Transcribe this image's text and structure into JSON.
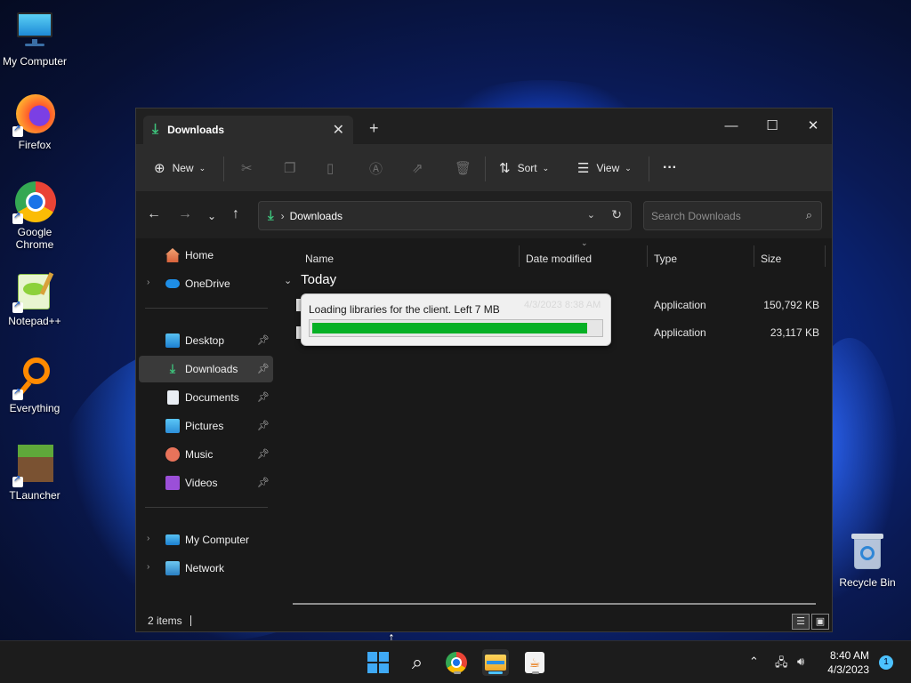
{
  "desktop": {
    "icons": [
      {
        "label": "My Computer",
        "icon": "monitor-icon"
      },
      {
        "label": "Firefox",
        "icon": "firefox-icon"
      },
      {
        "label": "Google Chrome",
        "icon": "chrome-icon"
      },
      {
        "label": "Notepad++",
        "icon": "notepadpp-icon"
      },
      {
        "label": "Everything",
        "icon": "everything-search-icon"
      },
      {
        "label": "TLauncher",
        "icon": "tlauncher-icon"
      },
      {
        "label": "Recycle Bin",
        "icon": "recycle-bin-icon"
      }
    ]
  },
  "window": {
    "tab_title": "Downloads",
    "new_tab": "+",
    "controls": {
      "minimize": "—",
      "maximize": "☐",
      "close": "✕"
    },
    "toolbar": {
      "new_label": "New",
      "sort_label": "Sort",
      "view_label": "View",
      "more_label": "···"
    },
    "address": {
      "crumb": "Downloads"
    },
    "search": {
      "placeholder": "Search Downloads"
    },
    "sidebar": {
      "items": [
        {
          "label": "Home"
        },
        {
          "label": "OneDrive"
        },
        {
          "label": "Desktop"
        },
        {
          "label": "Downloads"
        },
        {
          "label": "Documents"
        },
        {
          "label": "Pictures"
        },
        {
          "label": "Music"
        },
        {
          "label": "Videos"
        },
        {
          "label": "My Computer"
        },
        {
          "label": "Network"
        }
      ]
    },
    "columns": {
      "name": "Name",
      "date": "Date modified",
      "type": "Type",
      "size": "Size"
    },
    "group": "Today",
    "files": [
      {
        "date": "4/3/2023 8:38 AM",
        "type": "Application",
        "size": "150,792 KB"
      },
      {
        "type": "Application",
        "size": "23,117 KB"
      }
    ],
    "status": "2 items"
  },
  "loader": {
    "text": "Loading libraries for the client. Left 7 MB",
    "progress": 0.95,
    "fill_color": "#06b025"
  },
  "taskbar": {
    "time": "8:40 AM",
    "date": "4/3/2023",
    "notifications": "1"
  }
}
